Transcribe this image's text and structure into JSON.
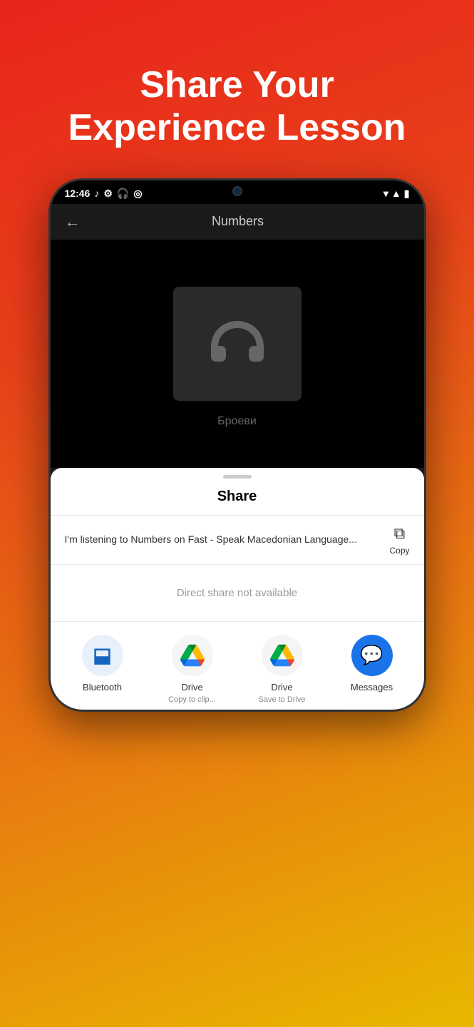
{
  "header": {
    "title": "Share Your\nExperience Lesson"
  },
  "status_bar": {
    "time": "12:46",
    "wifi": "▼",
    "signal": "▲",
    "battery": "🔋"
  },
  "app_bar": {
    "back": "←",
    "title": "Numbers"
  },
  "content": {
    "subtitle": "Броеви"
  },
  "share_sheet": {
    "handle": "",
    "title": "Share",
    "message": "I'm listening to Numbers on Fast - Speak Macedonian Language...",
    "copy_label": "Copy",
    "direct_share_text": "Direct share not available",
    "apps": [
      {
        "name": "Bluetooth",
        "sublabel": ""
      },
      {
        "name": "Drive",
        "sublabel": "Copy to clip..."
      },
      {
        "name": "Drive",
        "sublabel": "Save to Drive"
      },
      {
        "name": "Messages",
        "sublabel": ""
      }
    ]
  }
}
